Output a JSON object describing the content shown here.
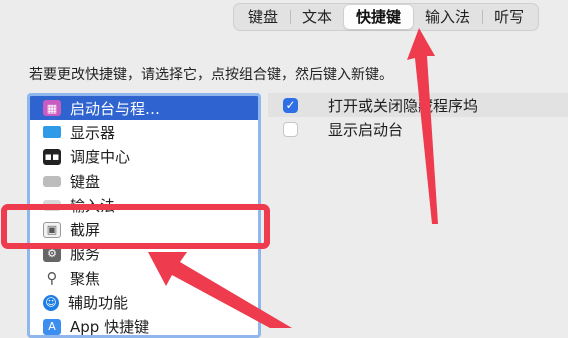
{
  "tabs": [
    {
      "label": "键盘",
      "selected": false
    },
    {
      "label": "文本",
      "selected": false
    },
    {
      "label": "快捷键",
      "selected": true
    },
    {
      "label": "输入法",
      "selected": false
    },
    {
      "label": "听写",
      "selected": false
    }
  ],
  "instruction": "若要更改快捷键，请选择它，点按组合键，然后键入新键。",
  "categories": [
    {
      "label": "启动台与程…",
      "icon": "launchpad-icon",
      "selected": true
    },
    {
      "label": "显示器",
      "icon": "display-icon",
      "selected": false
    },
    {
      "label": "调度中心",
      "icon": "mission-control-icon",
      "selected": false
    },
    {
      "label": "键盘",
      "icon": "keyboard-icon",
      "selected": false
    },
    {
      "label": "输入法",
      "icon": "input-method-icon",
      "selected": false
    },
    {
      "label": "截屏",
      "icon": "screenshot-icon",
      "selected": false
    },
    {
      "label": "服务",
      "icon": "services-icon",
      "selected": false
    },
    {
      "label": "聚焦",
      "icon": "spotlight-icon",
      "selected": false
    },
    {
      "label": "辅助功能",
      "icon": "accessibility-icon",
      "selected": false
    },
    {
      "label": "App 快捷键",
      "icon": "app-shortcuts-icon",
      "selected": false
    }
  ],
  "shortcuts": [
    {
      "label": "打开或关闭隐藏程序坞",
      "checked": true
    },
    {
      "label": "显示启动台",
      "checked": false
    }
  ],
  "annotation_color": "#ee3b4d"
}
